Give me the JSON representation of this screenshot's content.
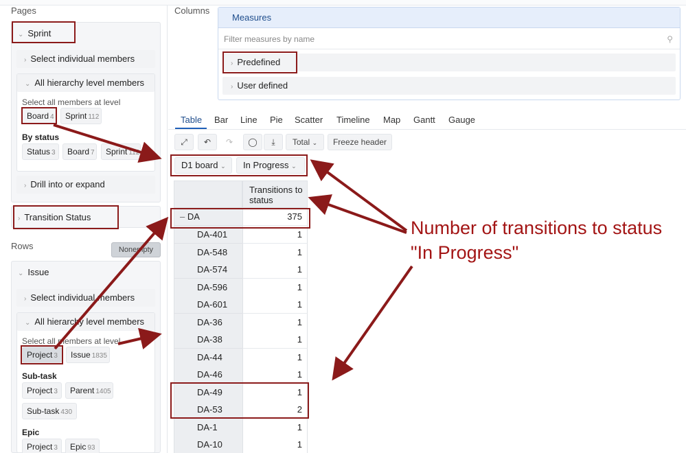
{
  "pages": {
    "title": "Pages",
    "dimension": "Sprint",
    "select_individual": "Select individual members",
    "all_hierarchy": "All hierarchy level members",
    "select_all_at_level": "Select all members at level",
    "levels": [
      {
        "label": "Board",
        "count": "4"
      },
      {
        "label": "Sprint",
        "count": "112"
      }
    ],
    "by_status_label": "By status",
    "status_levels": [
      {
        "label": "Status",
        "count": "3"
      },
      {
        "label": "Board",
        "count": "7"
      },
      {
        "label": "Sprint",
        "count": "112"
      }
    ],
    "drill": "Drill into or expand",
    "transition_status": "Transition Status"
  },
  "rows": {
    "title": "Rows",
    "nonempty": "Nonempty",
    "dimension": "Issue",
    "select_individual": "Select individual members",
    "all_hierarchy": "All hierarchy level members",
    "select_all_at_level": "Select all members at level",
    "levels": [
      {
        "label": "Project",
        "count": "3"
      },
      {
        "label": "Issue",
        "count": "1835"
      }
    ],
    "subtask_label": "Sub-task",
    "subtask_levels": [
      {
        "label": "Project",
        "count": "3"
      },
      {
        "label": "Parent",
        "count": "1405"
      },
      {
        "label": "Sub-task",
        "count": "430"
      }
    ],
    "epic_label": "Epic",
    "epic_levels": [
      {
        "label": "Project",
        "count": "3"
      },
      {
        "label": "Epic",
        "count": "93"
      }
    ]
  },
  "columns": {
    "title": "Columns",
    "measures": "Measures",
    "filter_placeholder": "Filter measures by name",
    "predefined": "Predefined",
    "user_defined": "User defined"
  },
  "tabs": [
    "Table",
    "Bar",
    "Line",
    "Pie",
    "Scatter",
    "Timeline",
    "Map",
    "Gantt",
    "Gauge"
  ],
  "toolbar": {
    "total": "Total",
    "freeze": "Freeze header"
  },
  "filters": {
    "board": "D1 board",
    "status": "In Progress"
  },
  "table": {
    "header": "Transitions to status",
    "total_row": {
      "label": "DA",
      "value": "375"
    },
    "rows": [
      {
        "label": "DA-401",
        "value": "1"
      },
      {
        "label": "DA-548",
        "value": "1"
      },
      {
        "label": "DA-574",
        "value": "1"
      },
      {
        "label": "DA-596",
        "value": "1"
      },
      {
        "label": "DA-601",
        "value": "1"
      },
      {
        "label": "DA-36",
        "value": "1"
      },
      {
        "label": "DA-38",
        "value": "1"
      },
      {
        "label": "DA-44",
        "value": "1"
      },
      {
        "label": "DA-46",
        "value": "1"
      },
      {
        "label": "DA-49",
        "value": "1"
      },
      {
        "label": "DA-53",
        "value": "2"
      },
      {
        "label": "DA-1",
        "value": "1"
      },
      {
        "label": "DA-10",
        "value": "1"
      }
    ]
  },
  "annotation": {
    "line1": "Number of transitions to status",
    "line2": "\"In Progress\""
  },
  "colors": {
    "annotation": "#a31515",
    "accent": "#1f5fb8"
  }
}
